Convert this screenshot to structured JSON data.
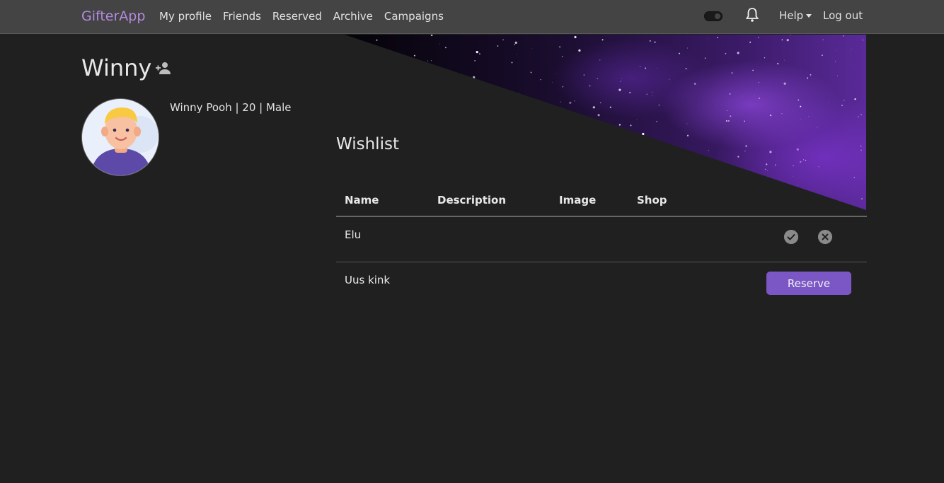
{
  "navbar": {
    "brand": "GifterApp",
    "links": [
      "My profile",
      "Friends",
      "Reserved",
      "Archive",
      "Campaigns"
    ],
    "help_label": "Help",
    "logout_label": "Log out"
  },
  "profile": {
    "name": "Winny",
    "info": "Winny Pooh | 20 | Male"
  },
  "wishlist": {
    "title": "Wishlist",
    "columns": [
      "Name",
      "Description",
      "Image",
      "Shop"
    ],
    "rows": [
      {
        "name": "Elu"
      },
      {
        "name": "Uus kink",
        "action_label": "Reserve"
      }
    ]
  },
  "colors": {
    "brand": "#b48be0",
    "accent": "#7b57c6",
    "background": "#202020",
    "navbar": "#444444"
  },
  "icons": [
    "bell-icon",
    "add-friend-icon",
    "check-circle-icon",
    "close-circle-icon",
    "dark-mode-toggle"
  ]
}
